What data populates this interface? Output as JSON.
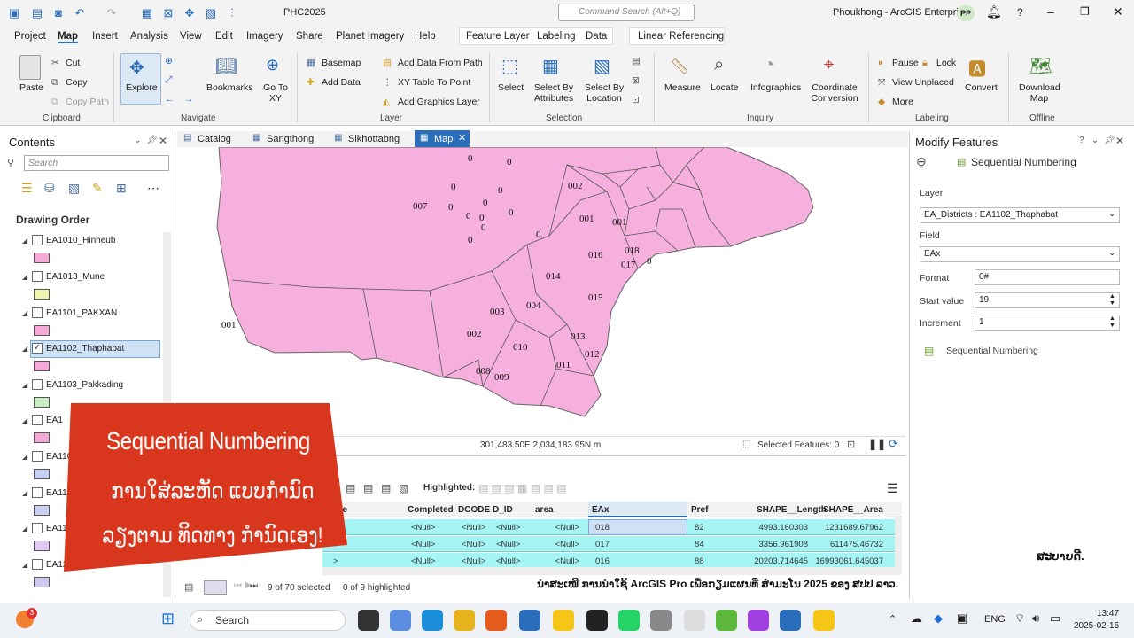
{
  "titlebar": {
    "project": "PHC2025",
    "command_search": "Command Search (Alt+Q)",
    "user": "Phoukhong - ArcGIS Enterprise",
    "avatar": "PP",
    "help": "?"
  },
  "menu": {
    "items": [
      "Project",
      "Map",
      "Insert",
      "Analysis",
      "View",
      "Edit",
      "Imagery",
      "Share",
      "Planet Imagery",
      "Help"
    ],
    "active": "Map",
    "context_tabs": [
      "Feature Layer",
      "Labeling",
      "Data"
    ],
    "linear": "Linear Referencing"
  },
  "ribbon": {
    "clipboard": {
      "paste": "Paste",
      "cut": "Cut",
      "copy": "Copy",
      "copy_path": "Copy Path",
      "group": "Clipboard"
    },
    "navigate": {
      "explore": "Explore",
      "bookmarks": "Bookmarks",
      "goto": "Go To XY",
      "group": "Navigate"
    },
    "layer": {
      "basemap": "Basemap",
      "add_data": "Add Data",
      "add_from_path": "Add Data From Path",
      "xy_table": "XY Table To Point",
      "add_graphics": "Add Graphics Layer",
      "group": "Layer"
    },
    "selection": {
      "select": "Select",
      "by_attr": "Select By Attributes",
      "by_loc": "Select By Location",
      "group": "Selection"
    },
    "inquiry": {
      "measure": "Measure",
      "locate": "Locate",
      "infographics": "Infographics",
      "coord": "Coordinate Conversion",
      "group": "Inquiry"
    },
    "labeling": {
      "pause": "Pause",
      "lock": "Lock",
      "view_unplaced": "View Unplaced",
      "more": "More",
      "convert": "Convert",
      "group": "Labeling"
    },
    "offline": {
      "download": "Download Map",
      "group": "Offline"
    }
  },
  "contents": {
    "title": "Contents",
    "search": "Search",
    "drawing_order": "Drawing Order",
    "layers": [
      {
        "name": "EA1010_Hinheub",
        "checked": false,
        "color": "#f5a9d8"
      },
      {
        "name": "EA1013_Mune",
        "checked": false,
        "color": "#eef5b0"
      },
      {
        "name": "EA1101_PAKXAN",
        "checked": false,
        "color": "#f5a9d8"
      },
      {
        "name": "EA1102_Thaphabat",
        "checked": true,
        "color": "#f5a9d8"
      },
      {
        "name": "EA1103_Pakkading",
        "checked": false,
        "color": "#c8f0c0"
      },
      {
        "name": "EA1",
        "checked": false,
        "color": "#f5a9d8"
      },
      {
        "name": "EA1105_",
        "checked": false,
        "color": "#c8d0f5"
      },
      {
        "name": "EA1106_Via",
        "checked": false,
        "color": "#c8d0f5"
      },
      {
        "name": "EA1107_",
        "checked": false,
        "color": "#e0c8f5"
      },
      {
        "name": "EA12",
        "checked": false,
        "color": "#d0c8f0"
      }
    ]
  },
  "tabs": [
    {
      "label": "Catalog"
    },
    {
      "label": "Sangthong"
    },
    {
      "label": "Sikhottabng"
    },
    {
      "label": "Map",
      "active": true
    }
  ],
  "map": {
    "fill": "#f5b0dd",
    "stroke": "#666",
    "labels": [
      {
        "t": "0"
      },
      {
        "t": "0"
      },
      {
        "t": "002"
      },
      {
        "t": "0"
      },
      {
        "t": "0"
      },
      {
        "t": "007"
      },
      {
        "t": "0"
      },
      {
        "t": "0"
      },
      {
        "t": "0"
      },
      {
        "t": "0"
      },
      {
        "t": "001"
      },
      {
        "t": "001"
      },
      {
        "t": "0"
      },
      {
        "t": "0"
      },
      {
        "t": "0"
      },
      {
        "t": "016"
      },
      {
        "t": "018"
      },
      {
        "t": "017"
      },
      {
        "t": "0"
      },
      {
        "t": "0"
      },
      {
        "t": "014"
      },
      {
        "t": "015"
      },
      {
        "t": "004"
      },
      {
        "t": "001"
      },
      {
        "t": "003"
      },
      {
        "t": "002"
      },
      {
        "t": "010"
      },
      {
        "t": "013"
      },
      {
        "t": "012"
      },
      {
        "t": "011"
      },
      {
        "t": "008"
      },
      {
        "t": "009"
      }
    ],
    "coords": "301,483.50E 2,034,183.95N m",
    "selected": "Selected Features: 0"
  },
  "attr": {
    "highlighted": "Highlighted:",
    "columns": [
      "ame",
      "Completed",
      "DCODE",
      "D_ID",
      "area",
      "EAx",
      "Pref",
      "SHAPE__Length",
      "SHAPE__Area"
    ],
    "rows": [
      [
        ">",
        "<Null>",
        "<Null>",
        "<Null>",
        "<Null>",
        "018",
        "82",
        "4993.160303",
        "1231689.67962"
      ],
      [
        ">",
        "<Null>",
        "<Null>",
        "<Null>",
        "<Null>",
        "017",
        "84",
        "3356.961908",
        "611475.46732"
      ],
      [
        ">",
        "<Null>",
        "<Null>",
        "<Null>",
        "<Null>",
        "016",
        "88",
        "20203.714645",
        "16993061.645037"
      ]
    ],
    "status1": "9 of 70 selected",
    "status2": "0 of 9 highlighted"
  },
  "modify": {
    "title": "Modify Features",
    "tool": "Sequential Numbering",
    "layer_label": "Layer",
    "layer_value": "EA_Districts : EA1102_Thaphabat",
    "field_label": "Field",
    "field_value": "EAx",
    "format_label": "Format",
    "format_value": "0#",
    "start_label": "Start value",
    "start_value": "19",
    "inc_label": "Increment",
    "inc_value": "1",
    "tool_item": "Sequential Numbering"
  },
  "banner": {
    "title": "Sequential Numbering",
    "line1": "ການໃສ່ລະຫັດ ແບບກຳນົດ",
    "line2": "ລຽງຕາມ ທິດທາງ ກຳນົດເອງ!",
    "color": "#d8371e"
  },
  "overlay": {
    "sig": "ສະບາຍດີ.",
    "caption": "ນຳສະເໜີ ການນຳໃຊ້ ArcGIS Pro ເພື່ອກຽມແຜນທີ່ ສຳມະໂນ 2025 ຂອງ ສປປ ລາວ."
  },
  "taskbar": {
    "search": "Search",
    "lang": "ENG",
    "time": "13:47",
    "date": "2025-02-15",
    "badge": "3"
  }
}
